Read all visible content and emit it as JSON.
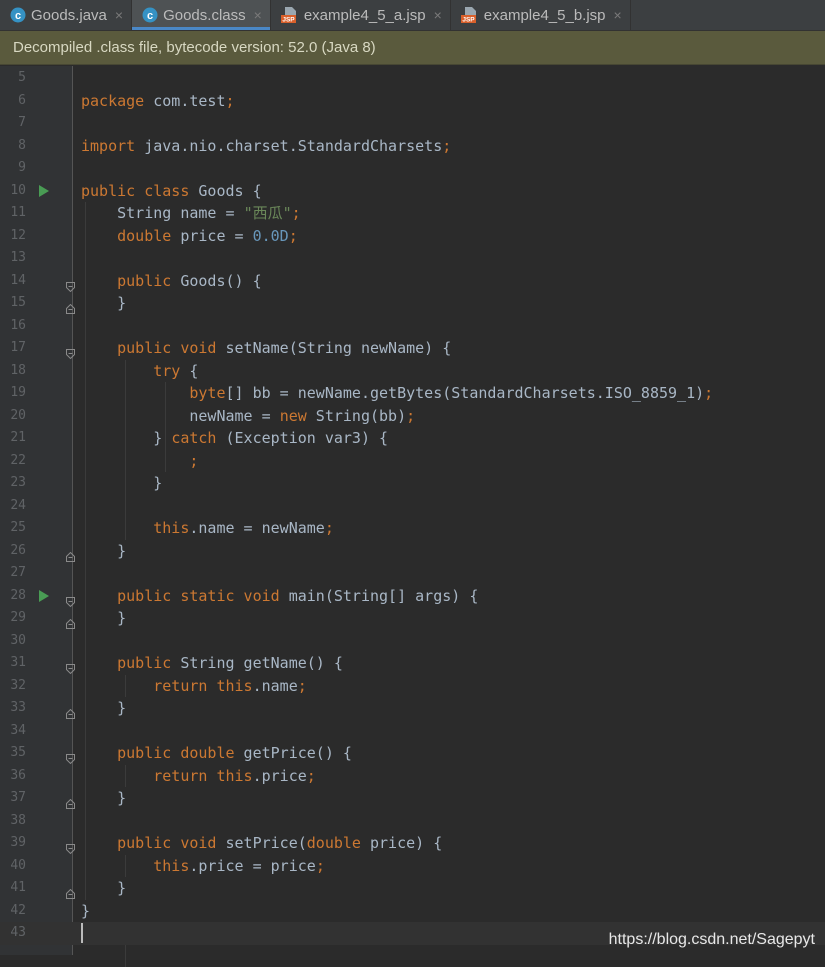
{
  "tabs": [
    {
      "label": "Goods.java",
      "icon": "java-class-icon",
      "active": false
    },
    {
      "label": "Goods.class",
      "icon": "java-class-icon",
      "active": true
    },
    {
      "label": "example4_5_a.jsp",
      "icon": "jsp-file-icon",
      "active": false
    },
    {
      "label": "example4_5_b.jsp",
      "icon": "jsp-file-icon",
      "active": false
    }
  ],
  "banner": {
    "text": "Decompiled .class file, bytecode version: 52.0 (Java 8)"
  },
  "colors": {
    "keyword": "#cc7832",
    "string": "#6a8759",
    "number": "#6897bb",
    "plain": "#a9b7c6",
    "banner": "#5a5a3d",
    "run_gutter": "#499c54"
  },
  "editor": {
    "lines": [
      {
        "n": "5",
        "tokens": []
      },
      {
        "n": "6",
        "tokens": [
          [
            "k",
            "package"
          ],
          [
            "p",
            " com.test"
          ],
          [
            "k",
            ";"
          ]
        ]
      },
      {
        "n": "7",
        "tokens": []
      },
      {
        "n": "8",
        "tokens": [
          [
            "k",
            "import"
          ],
          [
            "p",
            " java.nio.charset.StandardCharsets"
          ],
          [
            "k",
            ";"
          ]
        ]
      },
      {
        "n": "9",
        "tokens": []
      },
      {
        "n": "10",
        "run": true,
        "tokens": [
          [
            "k",
            "public class"
          ],
          [
            "p",
            " Goods {"
          ]
        ]
      },
      {
        "n": "11",
        "tokens": [
          [
            "p",
            "    String name = "
          ],
          [
            "s",
            "\"西瓜\""
          ],
          [
            "k",
            ";"
          ]
        ]
      },
      {
        "n": "12",
        "tokens": [
          [
            "p",
            "    "
          ],
          [
            "k",
            "double"
          ],
          [
            "p",
            " price = "
          ],
          [
            "n",
            "0.0D"
          ],
          [
            "k",
            ";"
          ]
        ]
      },
      {
        "n": "13",
        "tokens": []
      },
      {
        "n": "14",
        "fold": "open",
        "tokens": [
          [
            "p",
            "    "
          ],
          [
            "k",
            "public"
          ],
          [
            "p",
            " Goods() {"
          ]
        ]
      },
      {
        "n": "15",
        "fold": "close",
        "tokens": [
          [
            "p",
            "    }"
          ]
        ]
      },
      {
        "n": "16",
        "tokens": []
      },
      {
        "n": "17",
        "fold": "open",
        "tokens": [
          [
            "p",
            "    "
          ],
          [
            "k",
            "public void"
          ],
          [
            "p",
            " setName(String newName) {"
          ]
        ]
      },
      {
        "n": "18",
        "tokens": [
          [
            "p",
            "        "
          ],
          [
            "k",
            "try"
          ],
          [
            "p",
            " {"
          ]
        ]
      },
      {
        "n": "19",
        "tokens": [
          [
            "p",
            "            "
          ],
          [
            "k",
            "byte"
          ],
          [
            "p",
            "[] bb = newName.getBytes(StandardCharsets.ISO_8859_1)"
          ],
          [
            "k",
            ";"
          ]
        ]
      },
      {
        "n": "20",
        "tokens": [
          [
            "p",
            "            newName = "
          ],
          [
            "k",
            "new"
          ],
          [
            "p",
            " String(bb)"
          ],
          [
            "k",
            ";"
          ]
        ]
      },
      {
        "n": "21",
        "tokens": [
          [
            "p",
            "        } "
          ],
          [
            "k",
            "catch"
          ],
          [
            "p",
            " (Exception var3) {"
          ]
        ]
      },
      {
        "n": "22",
        "tokens": [
          [
            "p",
            "            "
          ],
          [
            "k",
            ";"
          ]
        ]
      },
      {
        "n": "23",
        "tokens": [
          [
            "p",
            "        }"
          ]
        ]
      },
      {
        "n": "24",
        "tokens": []
      },
      {
        "n": "25",
        "tokens": [
          [
            "p",
            "        "
          ],
          [
            "k",
            "this"
          ],
          [
            "p",
            ".name = newName"
          ],
          [
            "k",
            ";"
          ]
        ]
      },
      {
        "n": "26",
        "fold": "close",
        "tokens": [
          [
            "p",
            "    }"
          ]
        ]
      },
      {
        "n": "27",
        "tokens": []
      },
      {
        "n": "28",
        "run": true,
        "fold": "open",
        "tokens": [
          [
            "p",
            "    "
          ],
          [
            "k",
            "public static void"
          ],
          [
            "p",
            " main(String[] args) {"
          ]
        ]
      },
      {
        "n": "29",
        "fold": "close",
        "tokens": [
          [
            "p",
            "    }"
          ]
        ]
      },
      {
        "n": "30",
        "tokens": []
      },
      {
        "n": "31",
        "fold": "open",
        "tokens": [
          [
            "p",
            "    "
          ],
          [
            "k",
            "public"
          ],
          [
            "p",
            " String getName() {"
          ]
        ]
      },
      {
        "n": "32",
        "tokens": [
          [
            "p",
            "        "
          ],
          [
            "k",
            "return this"
          ],
          [
            "p",
            ".name"
          ],
          [
            "k",
            ";"
          ]
        ]
      },
      {
        "n": "33",
        "fold": "close",
        "tokens": [
          [
            "p",
            "    }"
          ]
        ]
      },
      {
        "n": "34",
        "tokens": []
      },
      {
        "n": "35",
        "fold": "open",
        "tokens": [
          [
            "p",
            "    "
          ],
          [
            "k",
            "public double"
          ],
          [
            "p",
            " getPrice() {"
          ]
        ]
      },
      {
        "n": "36",
        "tokens": [
          [
            "p",
            "        "
          ],
          [
            "k",
            "return this"
          ],
          [
            "p",
            ".price"
          ],
          [
            "k",
            ";"
          ]
        ]
      },
      {
        "n": "37",
        "fold": "close",
        "tokens": [
          [
            "p",
            "    }"
          ]
        ]
      },
      {
        "n": "38",
        "tokens": []
      },
      {
        "n": "39",
        "fold": "open",
        "tokens": [
          [
            "p",
            "    "
          ],
          [
            "k",
            "public void"
          ],
          [
            "p",
            " setPrice("
          ],
          [
            "k",
            "double"
          ],
          [
            "p",
            " price) {"
          ]
        ]
      },
      {
        "n": "40",
        "tokens": [
          [
            "p",
            "        "
          ],
          [
            "k",
            "this"
          ],
          [
            "p",
            ".price = price"
          ],
          [
            "k",
            ";"
          ]
        ]
      },
      {
        "n": "41",
        "fold": "close",
        "tokens": [
          [
            "p",
            "    }"
          ]
        ]
      },
      {
        "n": "42",
        "tokens": [
          [
            "p",
            "}"
          ]
        ]
      },
      {
        "n": "43",
        "current": true,
        "tokens": []
      }
    ]
  },
  "watermark": "https://blog.csdn.net/Sagepyt"
}
